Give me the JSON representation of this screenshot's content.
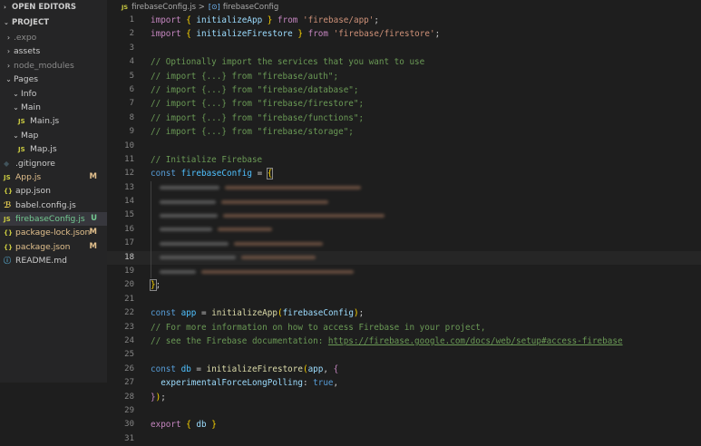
{
  "sidebar": {
    "open_editors_label": "OPEN EDITORS",
    "project_label": "PROJECT",
    "items": [
      {
        "label": ".expo",
        "kind": "folder-closed",
        "depth": 0,
        "muted": true
      },
      {
        "label": "assets",
        "kind": "folder-closed",
        "depth": 0
      },
      {
        "label": "node_modules",
        "kind": "folder-closed",
        "depth": 0,
        "muted": true
      },
      {
        "label": "Pages",
        "kind": "folder-open",
        "depth": 0
      },
      {
        "label": "Info",
        "kind": "folder-open",
        "depth": 1
      },
      {
        "label": "Main",
        "kind": "folder-open",
        "depth": 1
      },
      {
        "label": "Main.js",
        "kind": "js",
        "depth": 2
      },
      {
        "label": "Map",
        "kind": "folder-open",
        "depth": 1
      },
      {
        "label": "Map.js",
        "kind": "js",
        "depth": 2
      },
      {
        "label": ".gitignore",
        "kind": "git",
        "depth": 0
      },
      {
        "label": "App.js",
        "kind": "js",
        "depth": 0,
        "badge": "M",
        "status": "modified"
      },
      {
        "label": "app.json",
        "kind": "json",
        "depth": 0
      },
      {
        "label": "babel.config.js",
        "kind": "babel",
        "depth": 0
      },
      {
        "label": "firebaseConfig.js",
        "kind": "js",
        "depth": 0,
        "badge": "U",
        "status": "untracked",
        "selected": true
      },
      {
        "label": "package-lock.json",
        "kind": "json",
        "depth": 0,
        "badge": "M",
        "status": "modified"
      },
      {
        "label": "package.json",
        "kind": "json",
        "depth": 0,
        "badge": "M",
        "status": "modified"
      },
      {
        "label": "README.md",
        "kind": "info",
        "depth": 0
      }
    ]
  },
  "icons": {
    "js": "JS",
    "json": "{}",
    "babel": "ℬ",
    "git": "◆",
    "info": "ⓘ",
    "folder_closed": "›",
    "folder_open": "⌄",
    "section": "⌄",
    "section_closed": "›"
  },
  "breadcrumb": {
    "file": "firebaseConfig.js",
    "separator": ">",
    "symbol": "firebaseConfig",
    "file_icon": "JS",
    "symbol_icon": "[⊙]"
  },
  "editor": {
    "current_line": 18,
    "lines": [
      {
        "n": "1",
        "tokens": [
          [
            "kw",
            "import"
          ],
          [
            "p",
            " "
          ],
          [
            "brk",
            "{"
          ],
          [
            "p",
            " "
          ],
          [
            "var",
            "initializeApp"
          ],
          [
            "p",
            " "
          ],
          [
            "brk",
            "}"
          ],
          [
            "p",
            " "
          ],
          [
            "kw",
            "from"
          ],
          [
            "p",
            " "
          ],
          [
            "str",
            "'firebase/app'"
          ],
          [
            "p",
            ";"
          ]
        ]
      },
      {
        "n": "2",
        "tokens": [
          [
            "kw",
            "import"
          ],
          [
            "p",
            " "
          ],
          [
            "brk",
            "{"
          ],
          [
            "p",
            " "
          ],
          [
            "var",
            "initializeFirestore"
          ],
          [
            "p",
            " "
          ],
          [
            "brk",
            "}"
          ],
          [
            "p",
            " "
          ],
          [
            "kw",
            "from"
          ],
          [
            "p",
            " "
          ],
          [
            "str",
            "'firebase/firestore'"
          ],
          [
            "p",
            ";"
          ]
        ]
      },
      {
        "n": "3",
        "tokens": []
      },
      {
        "n": "4",
        "tokens": [
          [
            "cm",
            "// Optionally import the services that you want to use"
          ]
        ]
      },
      {
        "n": "5",
        "tokens": [
          [
            "cm",
            "// import {...} from \"firebase/auth\";"
          ]
        ]
      },
      {
        "n": "6",
        "tokens": [
          [
            "cm",
            "// import {...} from \"firebase/database\";"
          ]
        ]
      },
      {
        "n": "7",
        "tokens": [
          [
            "cm",
            "// import {...} from \"firebase/firestore\";"
          ]
        ]
      },
      {
        "n": "8",
        "tokens": [
          [
            "cm",
            "// import {...} from \"firebase/functions\";"
          ]
        ]
      },
      {
        "n": "9",
        "tokens": [
          [
            "cm",
            "// import {...} from \"firebase/storage\";"
          ]
        ]
      },
      {
        "n": "10",
        "tokens": []
      },
      {
        "n": "11",
        "tokens": [
          [
            "cm",
            "// Initialize Firebase"
          ]
        ]
      },
      {
        "n": "12",
        "tokens": [
          [
            "kb",
            "const"
          ],
          [
            "p",
            " "
          ],
          [
            "cst",
            "firebaseConfig"
          ],
          [
            "p",
            " = "
          ],
          [
            "brkbox",
            "{"
          ]
        ]
      },
      {
        "n": "13",
        "blur": [
          66,
          150
        ]
      },
      {
        "n": "14",
        "blur": [
          62,
          118
        ]
      },
      {
        "n": "15",
        "blur": [
          64,
          178
        ]
      },
      {
        "n": "16",
        "blur": [
          58,
          60
        ]
      },
      {
        "n": "17",
        "blur": [
          76,
          98
        ]
      },
      {
        "n": "18",
        "blur": [
          84,
          82
        ]
      },
      {
        "n": "19",
        "blur": [
          40,
          168
        ]
      },
      {
        "n": "20",
        "tokens": [
          [
            "brkbox",
            "}"
          ],
          [
            "p",
            ";"
          ]
        ]
      },
      {
        "n": "21",
        "tokens": []
      },
      {
        "n": "22",
        "tokens": [
          [
            "kb",
            "const"
          ],
          [
            "p",
            " "
          ],
          [
            "cst",
            "app"
          ],
          [
            "p",
            " = "
          ],
          [
            "fn",
            "initializeApp"
          ],
          [
            "brk",
            "("
          ],
          [
            "var",
            "firebaseConfig"
          ],
          [
            "brk",
            ")"
          ],
          [
            "p",
            ";"
          ]
        ]
      },
      {
        "n": "23",
        "tokens": [
          [
            "cm",
            "// For more information on how to access Firebase in your project,"
          ]
        ]
      },
      {
        "n": "24",
        "tokens": [
          [
            "cm",
            "// see the Firebase documentation: "
          ],
          [
            "lnk",
            "https://firebase.google.com/docs/web/setup#access-firebase"
          ]
        ]
      },
      {
        "n": "25",
        "tokens": []
      },
      {
        "n": "26",
        "tokens": [
          [
            "kb",
            "const"
          ],
          [
            "p",
            " "
          ],
          [
            "cst",
            "db"
          ],
          [
            "p",
            " = "
          ],
          [
            "fn",
            "initializeFirestore"
          ],
          [
            "brk",
            "("
          ],
          [
            "var",
            "app"
          ],
          [
            "p",
            ", "
          ],
          [
            "kw",
            "{"
          ]
        ]
      },
      {
        "n": "27",
        "tokens": [
          [
            "p",
            "  "
          ],
          [
            "var",
            "experimentalForceLongPolling"
          ],
          [
            "p",
            ": "
          ],
          [
            "kb",
            "true"
          ],
          [
            "p",
            ","
          ]
        ]
      },
      {
        "n": "28",
        "tokens": [
          [
            "kw",
            "}"
          ],
          [
            "brk",
            ")"
          ],
          [
            "p",
            ";"
          ]
        ]
      },
      {
        "n": "29",
        "tokens": []
      },
      {
        "n": "30",
        "tokens": [
          [
            "kw",
            "export"
          ],
          [
            "p",
            " "
          ],
          [
            "brk",
            "{"
          ],
          [
            "p",
            " "
          ],
          [
            "var",
            "db"
          ],
          [
            "p",
            " "
          ],
          [
            "brk",
            "}"
          ]
        ]
      },
      {
        "n": "31",
        "tokens": []
      }
    ]
  },
  "colors": {
    "modified": "#e2c08d",
    "untracked": "#73c991",
    "js_icon": "#cbcb41",
    "json_icon": "#cbcb41",
    "babel_icon": "#f5da55",
    "git_icon": "#41535b",
    "info_icon": "#519aba"
  }
}
